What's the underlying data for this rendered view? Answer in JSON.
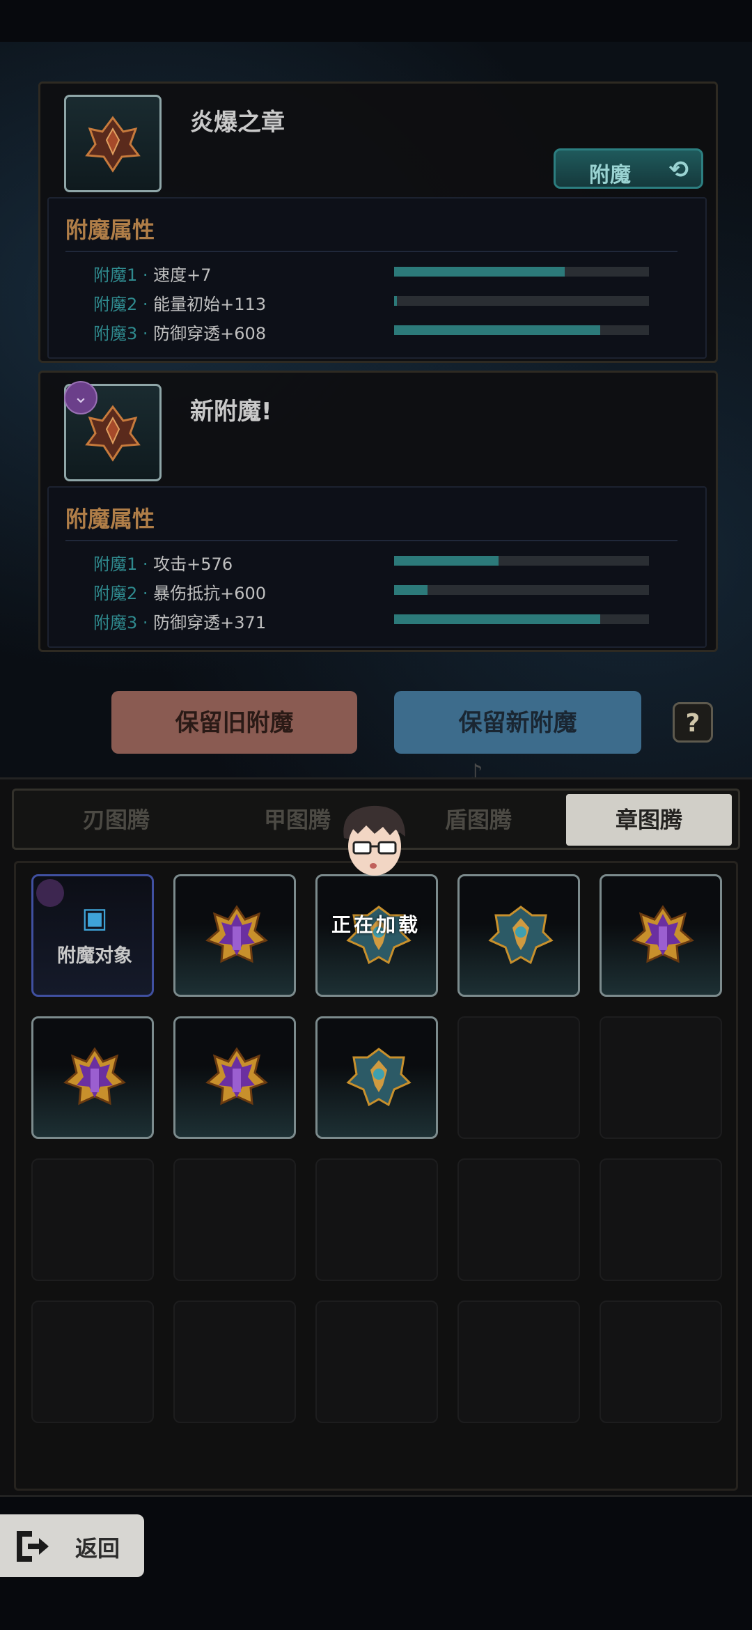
{
  "panels": {
    "old": {
      "name": "炎爆之章",
      "enchant_button": "附魔",
      "attr_title": "附魔属性",
      "attrs": [
        {
          "key": "附魔1",
          "sep": " · ",
          "value": "速度+7",
          "fill": 0.67
        },
        {
          "key": "附魔2",
          "sep": " · ",
          "value": "能量初始+113",
          "fill": 0.01
        },
        {
          "key": "附魔3",
          "sep": " · ",
          "value": "防御穿透+608",
          "fill": 0.81
        }
      ]
    },
    "new": {
      "name": "新附魔!",
      "attr_title": "附魔属性",
      "attrs": [
        {
          "key": "附魔1",
          "sep": " · ",
          "value": "攻击+576",
          "fill": 0.41
        },
        {
          "key": "附魔2",
          "sep": " · ",
          "value": "暴伤抵抗+600",
          "fill": 0.13
        },
        {
          "key": "附魔3",
          "sep": " · ",
          "value": "防御穿透+371",
          "fill": 0.81
        }
      ]
    }
  },
  "buttons": {
    "keep_old": "保留旧附魔",
    "keep_new": "保留新附魔",
    "help": "?",
    "back": "返回"
  },
  "tabs": [
    {
      "label": "刃图腾",
      "active": false
    },
    {
      "label": "甲图腾",
      "active": false
    },
    {
      "label": "盾图腾",
      "active": false
    },
    {
      "label": "章图腾",
      "active": true
    }
  ],
  "grid": {
    "target_label": "附魔对象",
    "loading_text": "正在加载",
    "slots": [
      "target",
      "purple",
      "teal",
      "teal",
      "purple",
      "purple",
      "purple",
      "teal",
      "empty",
      "empty",
      "empty",
      "empty",
      "empty",
      "empty",
      "empty",
      "empty",
      "empty",
      "empty",
      "empty",
      "empty"
    ]
  },
  "colors": {
    "accent_teal": "#2c7a7a",
    "attr_title": "#b07e48",
    "keep_old_bg": "#8a5b52",
    "keep_new_bg": "#3d6c8c"
  }
}
